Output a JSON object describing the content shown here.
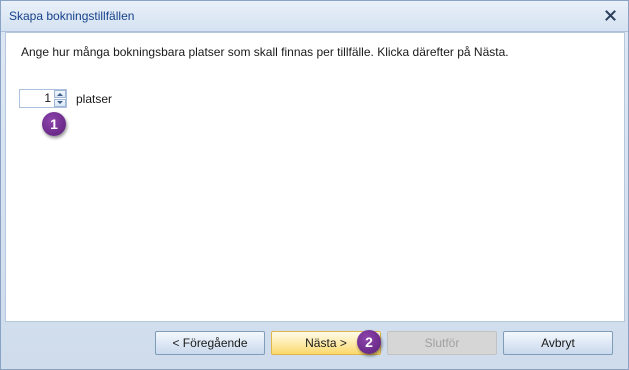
{
  "window": {
    "title": "Skapa bokningstillfällen"
  },
  "content": {
    "instruction": "Ange hur många bokningsbara platser som skall finnas per tillfälle. Klicka därefter på Nästa.",
    "spinner_value": "1",
    "spinner_unit": "platser"
  },
  "badges": {
    "one": "1",
    "two": "2"
  },
  "buttons": {
    "previous": "< Föregående",
    "next": "Nästa >",
    "finish": "Slutför",
    "cancel": "Avbryt"
  },
  "colors": {
    "title_text": "#15428b",
    "badge": "#6f2b93",
    "next_highlight": "#fde9a7"
  }
}
